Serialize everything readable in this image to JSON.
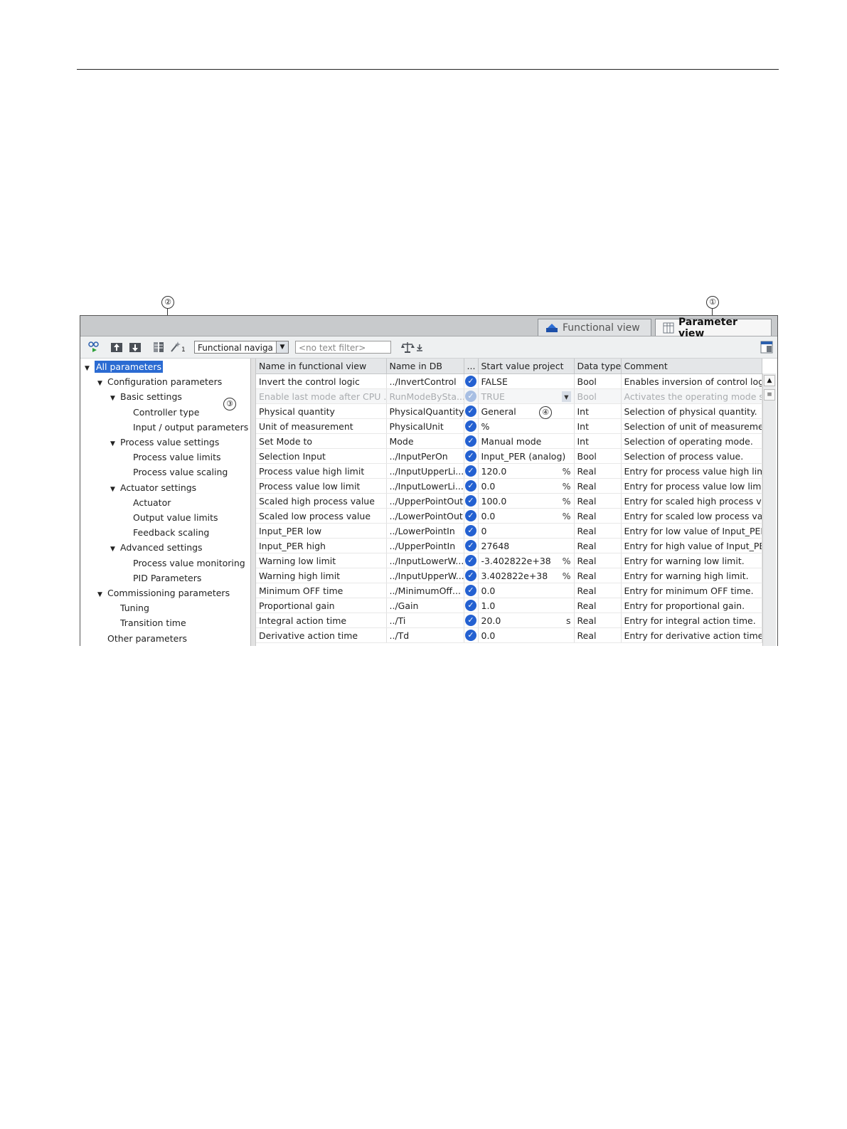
{
  "callouts": {
    "c1": "①",
    "c2": "②",
    "c3": "③",
    "c4": "④"
  },
  "tabs": {
    "functional": "Functional view",
    "parameter": "Parameter view"
  },
  "toolbar": {
    "navigation_select": "Functional naviga",
    "text_filter_placeholder": "<no text filter>",
    "wand_suffix": "1"
  },
  "tree": {
    "items": [
      {
        "label": "All parameters",
        "selected": true
      },
      {
        "label": "Configuration parameters"
      },
      {
        "label": "Basic settings"
      },
      {
        "label": "Controller type"
      },
      {
        "label": "Input / output parameters"
      },
      {
        "label": "Process value settings"
      },
      {
        "label": "Process value limits"
      },
      {
        "label": "Process value scaling"
      },
      {
        "label": "Actuator settings"
      },
      {
        "label": "Actuator"
      },
      {
        "label": "Output value limits"
      },
      {
        "label": "Feedback scaling"
      },
      {
        "label": "Advanced settings"
      },
      {
        "label": "Process value monitoring"
      },
      {
        "label": "PID Parameters"
      },
      {
        "label": "Commissioning parameters"
      },
      {
        "label": "Tuning"
      },
      {
        "label": "Transition time"
      },
      {
        "label": "Other parameters"
      }
    ]
  },
  "table": {
    "headers": {
      "name_functional": "Name in functional view",
      "name_db": "Name in DB",
      "dots": "...",
      "start_value": "Start value project",
      "data_type": "Data type",
      "comment": "Comment"
    },
    "rows": [
      {
        "name": "Invert the control logic",
        "db": "../InvertControl",
        "value": "FALSE",
        "unit": "",
        "type": "Bool",
        "comment": "Enables inversion of control log"
      },
      {
        "name": "Enable last mode after CPU ...",
        "db": "RunModeBySta...",
        "value": "TRUE",
        "unit": "",
        "type": "Bool",
        "comment": "Activates the operating mode s",
        "dim": true
      },
      {
        "name": "Physical quantity",
        "db": "PhysicalQuantity",
        "value": "General",
        "unit": "",
        "type": "Int",
        "comment": "Selection of physical quantity."
      },
      {
        "name": "Unit of measurement",
        "db": "PhysicalUnit",
        "value": "%",
        "unit": "",
        "type": "Int",
        "comment": "Selection of unit of measureme"
      },
      {
        "name": "Set Mode to",
        "db": "Mode",
        "value": "Manual mode",
        "unit": "",
        "type": "Int",
        "comment": "Selection of operating mode."
      },
      {
        "name": "Selection Input",
        "db": "../InputPerOn",
        "value": "Input_PER (analog)",
        "unit": "",
        "type": "Bool",
        "comment": "Selection of process value."
      },
      {
        "name": "Process value high limit",
        "db": "../InputUpperLi...",
        "value": "120.0",
        "unit": "%",
        "type": "Real",
        "comment": "Entry for process value high lim"
      },
      {
        "name": "Process value low limit",
        "db": "../InputLowerLi...",
        "value": "0.0",
        "unit": "%",
        "type": "Real",
        "comment": "Entry for process value low limit"
      },
      {
        "name": "Scaled high process value",
        "db": "../UpperPointOut",
        "value": "100.0",
        "unit": "%",
        "type": "Real",
        "comment": "Entry for scaled high process va"
      },
      {
        "name": "Scaled low process value",
        "db": "../LowerPointOut",
        "value": "0.0",
        "unit": "%",
        "type": "Real",
        "comment": "Entry for scaled low process val"
      },
      {
        "name": "Input_PER low",
        "db": "../LowerPointIn",
        "value": "0",
        "unit": "",
        "type": "Real",
        "comment": "Entry for low value of Input_PER."
      },
      {
        "name": "Input_PER high",
        "db": "../UpperPointIn",
        "value": "27648",
        "unit": "",
        "type": "Real",
        "comment": "Entry for high value of Input_PEF"
      },
      {
        "name": "Warning low limit",
        "db": "../InputLowerW...",
        "value": "-3.402822e+38",
        "unit": "%",
        "type": "Real",
        "comment": "Entry for warning low limit."
      },
      {
        "name": "Warning high limit",
        "db": "../InputUpperW...",
        "value": "3.402822e+38",
        "unit": "%",
        "type": "Real",
        "comment": "Entry for warning high limit."
      },
      {
        "name": "Minimum OFF time",
        "db": "../MinimumOff...",
        "value": "0.0",
        "unit": "",
        "type": "Real",
        "comment": "Entry for minimum OFF time."
      },
      {
        "name": "Proportional gain",
        "db": "../Gain",
        "value": "1.0",
        "unit": "",
        "type": "Real",
        "comment": "Entry for proportional gain."
      },
      {
        "name": "Integral action time",
        "db": "../Ti",
        "value": "20.0",
        "unit": "s",
        "type": "Real",
        "comment": "Entry for integral action time."
      },
      {
        "name": "Derivative action time",
        "db": "../Td",
        "value": "0.0",
        "unit": "",
        "type": "Real",
        "comment": "Entry for derivative action time."
      }
    ]
  },
  "colors": {
    "selection": "#2b6bd2",
    "check": "#2461d1",
    "tabbar": "#c8cacc"
  }
}
